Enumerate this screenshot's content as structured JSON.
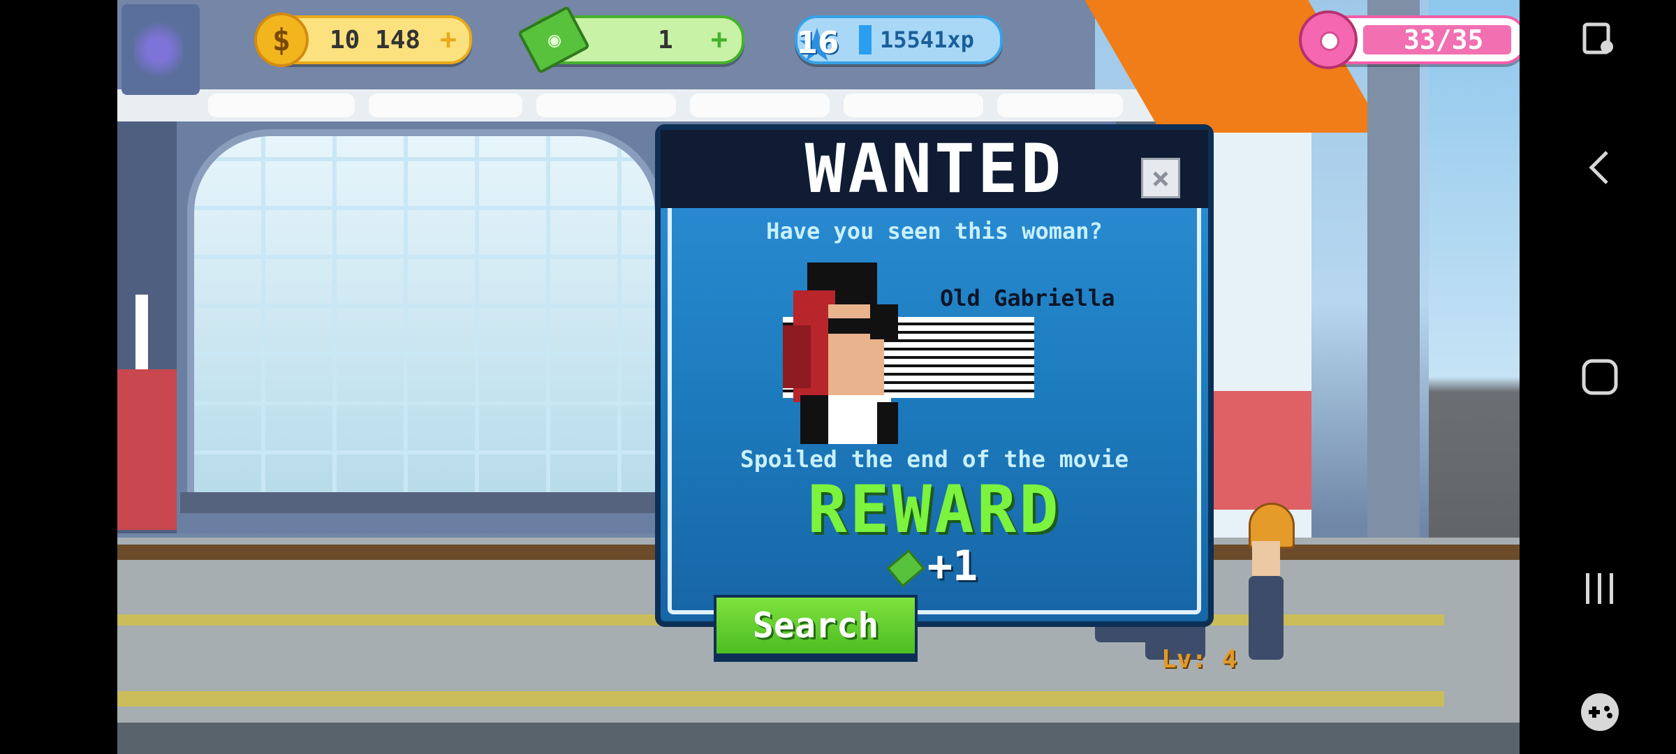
{
  "hud": {
    "coins": "10 148",
    "cash": "1",
    "level": "16",
    "xp": "15541xp",
    "donuts": "33/35",
    "plus_symbol": "+"
  },
  "wanted": {
    "title": "WANTED",
    "close_label": "×",
    "question": "Have you seen this woman?",
    "suspect_name": "Old Gabriella",
    "crime": "Spoiled the end of the movie",
    "reward_label": "REWARD",
    "reward_amount": "+1",
    "search_label": "Search"
  },
  "character": {
    "level_label": "Lv: 4"
  },
  "navbar": {
    "icons": [
      "screenshot-touch-icon",
      "back-icon",
      "home-icon",
      "recents-icon",
      "game-launcher-icon"
    ]
  },
  "colors": {
    "dialog_blue": "#1d7dbf",
    "header_navy": "#0f1c33",
    "reward_green": "#7cf33f",
    "coin_gold": "#f3b51e",
    "donut_pink": "#f26fb1"
  }
}
